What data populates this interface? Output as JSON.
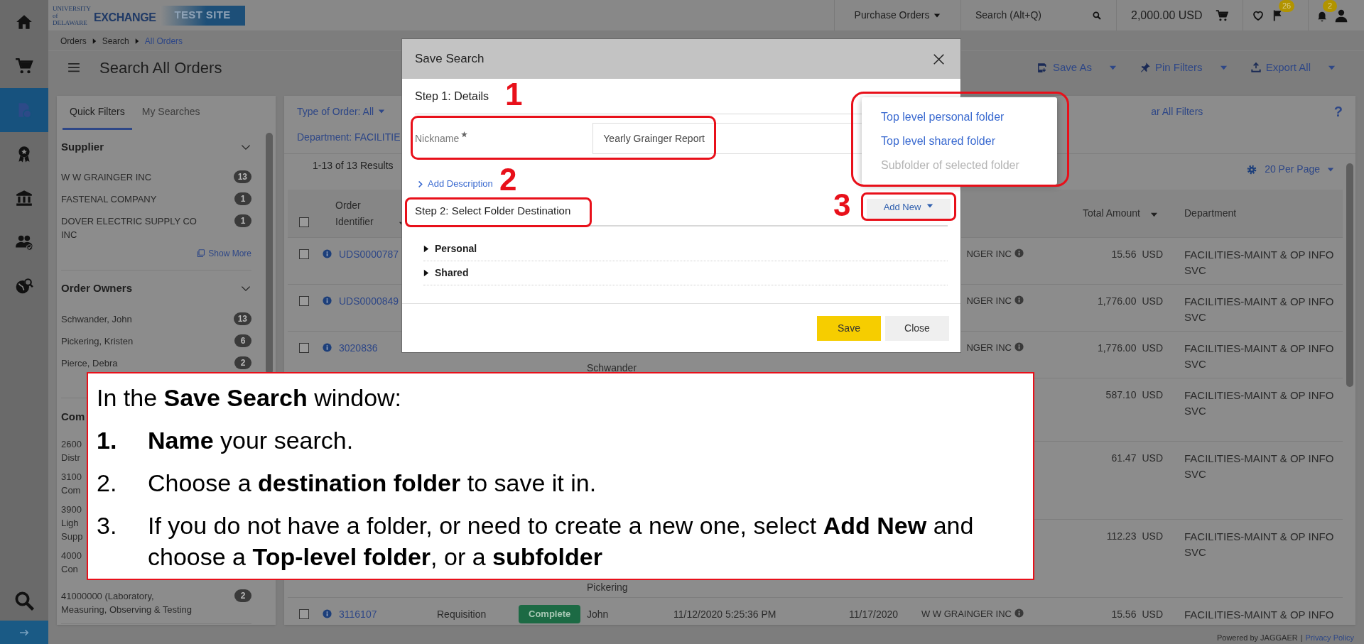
{
  "nav_rail": {
    "items": [
      {
        "kind": "home",
        "selected": false
      },
      {
        "kind": "cart",
        "selected": false
      },
      {
        "kind": "documents",
        "selected": true
      },
      {
        "kind": "award",
        "selected": false
      },
      {
        "kind": "bank",
        "selected": false
      },
      {
        "kind": "people",
        "selected": false
      },
      {
        "kind": "globe",
        "selected": false
      }
    ]
  },
  "header": {
    "logo_text": "UNIVERSITY of DELAWARE",
    "logo_product": "EXCHANGE",
    "site_banner": "TEST SITE",
    "menu": "Purchase Orders",
    "search_placeholder": "Search (Alt+Q)",
    "cart_total": "2,000.00 USD",
    "flag_badge": "26",
    "bell_badge": "2"
  },
  "breadcrumbs": [
    {
      "label": "Orders",
      "current": false
    },
    {
      "label": "Search",
      "current": false
    },
    {
      "label": "All Orders",
      "current": true
    }
  ],
  "page_title": "Search All Orders",
  "toolbar_actions": [
    {
      "kind": "save",
      "label": "Save As"
    },
    {
      "kind": "pin",
      "label": "Pin Filters"
    },
    {
      "kind": "export",
      "label": "Export All"
    }
  ],
  "filter_panel": {
    "tabs": [
      {
        "label": "Quick Filters",
        "selected": true
      },
      {
        "label": "My Searches",
        "selected": false
      }
    ],
    "sections": [
      {
        "title": "Supplier",
        "expanded": true,
        "items": [
          {
            "label": "W W GRAINGER INC",
            "count": "13"
          },
          {
            "label": "FASTENAL COMPANY",
            "count": "1"
          },
          {
            "label": "DOVER ELECTRIC SUPPLY CO INC",
            "count": "1"
          }
        ],
        "show_more": "Show More"
      },
      {
        "title": "Order Owners",
        "expanded": true,
        "items": [
          {
            "label": "Schwander, John",
            "count": "13"
          },
          {
            "label": "Pickering, Kristen",
            "count": "6"
          },
          {
            "label": "Pierce, Debra",
            "count": "2"
          }
        ]
      },
      {
        "title": "Com",
        "items": [
          {
            "lines": [
              "2600",
              "Distr"
            ]
          },
          {
            "lines": [
              "3100",
              "Com"
            ]
          },
          {
            "lines": [
              "3900",
              "Ligh",
              "Supp"
            ]
          },
          {
            "lines": [
              "4000",
              "Con"
            ]
          },
          {
            "lines": [
              "41000000 (Laboratory,",
              "Measuring, Observing & Testing"
            ],
            "count": "2"
          }
        ]
      }
    ]
  },
  "results": {
    "filters": [
      {
        "label": "Type of Order: All",
        "dropdown": true
      },
      {
        "label": "Department: FACILITIE",
        "dropdown": false
      }
    ],
    "clear_all": "ar All Filters",
    "help": "?",
    "summary": "1-13 of 13 Results",
    "per_page": "20 Per Page"
  },
  "table": {
    "select_all": false,
    "columns": [
      {
        "label": "Order Identifier",
        "sortable": true
      },
      {
        "label": "Total Amount",
        "sortable": true
      },
      {
        "label": "Department",
        "sortable": false
      }
    ],
    "rows": [
      {
        "selected": false,
        "id": "UDS0000787",
        "supplier": "NGER INC",
        "amount": "15.56",
        "currency": "USD",
        "department": "FACILITIES-MAINT & OP INFO SVC"
      },
      {
        "selected": false,
        "id": "UDS0000849",
        "supplier": "NGER INC",
        "amount": "1,776.00",
        "currency": "USD",
        "department": "FACILITIES-MAINT & OP INFO SVC"
      },
      {
        "selected": false,
        "id": "3020836",
        "owner": "Schwander",
        "supplier": "NGER INC",
        "amount": "1,776.00",
        "currency": "USD",
        "department": "FACILITIES-MAINT & OP INFO SVC"
      },
      {
        "amount": "587.10",
        "currency": "USD",
        "department": "FACILITIES-MAINT & OP INFO SVC"
      },
      {
        "amount": "61.47",
        "currency": "USD",
        "department": "FACILITIES-MAINT & OP INFO SVC"
      },
      {
        "owner": "Pickering",
        "amount": "112.23",
        "currency": "USD",
        "department": "FACILITIES-MAINT & OP INFO SVC"
      },
      {
        "selected": false,
        "id": "3116107",
        "type": "Requisition",
        "status": "Complete",
        "owner": "John",
        "created": "11/12/2020 5:25:36 PM",
        "date": "11/17/2020",
        "supplier": "W W GRAINGER INC",
        "amount": "15.56",
        "currency": "USD",
        "department": "FACILITIES-MAINT & OP INFO"
      }
    ]
  },
  "save_search_dialog": {
    "title": "Save Search",
    "step1_title": "Step 1: Details",
    "nickname_label": "Nickname",
    "nickname_required": true,
    "nickname_value": "Yearly Grainger Report",
    "add_description": "Add Description",
    "step2_title": "Step 2: Select Folder Destination",
    "add_new": "Add New",
    "folders": [
      {
        "label": "Personal",
        "expanded": false
      },
      {
        "label": "Shared",
        "expanded": false
      }
    ],
    "buttons": [
      {
        "kind": "primary",
        "label": "Save"
      },
      {
        "kind": "secondary",
        "label": "Close"
      }
    ]
  },
  "add_new_menu": [
    {
      "label": "Top level personal folder",
      "disabled": false
    },
    {
      "label": "Top level shared folder",
      "disabled": false
    },
    {
      "label": "Subfolder of selected folder",
      "disabled": true
    }
  ],
  "annotation_markers": [
    "1",
    "2",
    "3"
  ],
  "instructions": {
    "intro": "In the **Save Search** window:",
    "steps": [
      {
        "number": "1.",
        "bold_number": true,
        "text": "**Name** your search."
      },
      {
        "number": "2.",
        "bold_number": false,
        "text": "Choose a **destination folder** to save it in."
      },
      {
        "number": "3.",
        "bold_number": false,
        "text": "If you do not have a folder, or need to create a new one, select **Add New** and choose a **Top-level folder**, or a **subfolder**"
      }
    ]
  },
  "footer": {
    "powered_by": "Powered by JAGGAER",
    "separator": "|",
    "privacy_link": "Privacy Policy"
  }
}
